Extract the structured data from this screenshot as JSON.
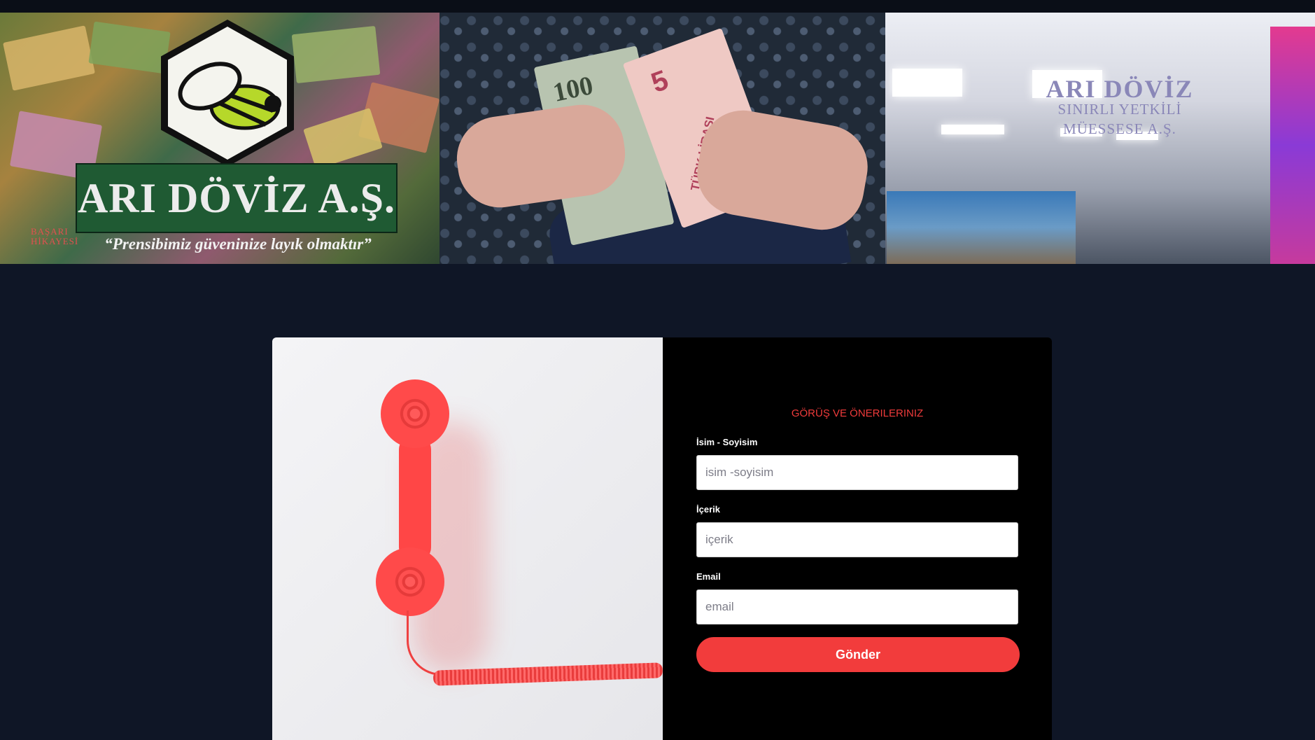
{
  "colors": {
    "page_bg": "#0f1626",
    "form_bg": "#000000",
    "accent": "#f23c3c",
    "title": "#ef3b3b"
  },
  "gallery": {
    "photo1": {
      "icon": "bee-hexagon-logo",
      "brand": "ARI DÖVİZ A.Ş.",
      "motto": "“Prensibimiz güveninize layık olmaktır”",
      "badge_line1": "BAŞARI",
      "badge_line2": "HİKAYESİ"
    },
    "photo2": {
      "icon": "hands-money-wallet",
      "bill_left": "100",
      "bill_right": "5",
      "bill_right_text": "TÜRK LİRASI"
    },
    "photo3": {
      "icon": "exchange-office-front",
      "sign_title": "ARI DÖVİZ",
      "sign_line1": "SINIRLI YETKİLİ",
      "sign_line2": "MÜESSESE A.Ş."
    }
  },
  "contact": {
    "image_icon": "red-telephone-handset",
    "title": "GÖRÜŞ VE ÖNERILERINIZ",
    "fields": [
      {
        "label": "İsim - Soyisim",
        "placeholder": "isim -soyisim",
        "value": ""
      },
      {
        "label": "İçerik",
        "placeholder": "içerik",
        "value": ""
      },
      {
        "label": "Email",
        "placeholder": "email",
        "value": ""
      }
    ],
    "submit_label": "Gönder"
  }
}
